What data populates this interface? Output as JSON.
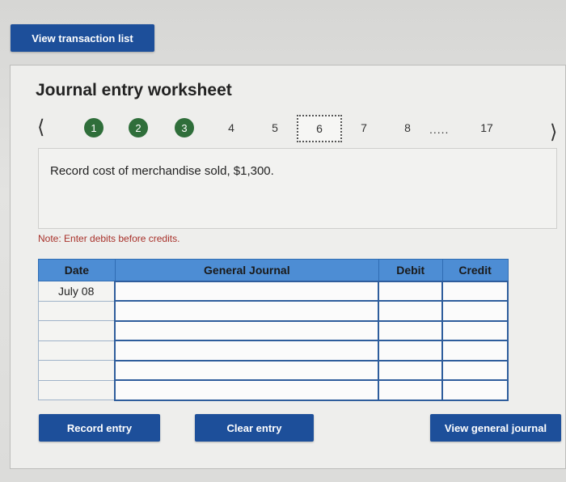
{
  "top": {
    "view_transactions_label": "View transaction list"
  },
  "worksheet": {
    "title": "Journal entry worksheet",
    "steps": [
      "1",
      "2",
      "3",
      "4",
      "5",
      "6",
      "7",
      "8",
      "17"
    ],
    "ellipsis": ".....",
    "current_step": "6",
    "completed_steps": [
      "1",
      "2",
      "3"
    ],
    "prev_icon": "chevron-left-icon",
    "next_icon": "chevron-right-icon",
    "prompt": "Record cost of merchandise sold, $1,300.",
    "note": "Note: Enter debits before credits."
  },
  "journal": {
    "headers": {
      "date": "Date",
      "general_journal": "General Journal",
      "debit": "Debit",
      "credit": "Credit"
    },
    "rows": [
      {
        "date": "July 08",
        "account": "",
        "debit": "",
        "credit": ""
      },
      {
        "date": "",
        "account": "",
        "debit": "",
        "credit": ""
      },
      {
        "date": "",
        "account": "",
        "debit": "",
        "credit": ""
      },
      {
        "date": "",
        "account": "",
        "debit": "",
        "credit": ""
      },
      {
        "date": "",
        "account": "",
        "debit": "",
        "credit": ""
      },
      {
        "date": "",
        "account": "",
        "debit": "",
        "credit": ""
      }
    ]
  },
  "actions": {
    "record_entry": "Record entry",
    "clear_entry": "Clear entry",
    "view_general_journal": "View general journal"
  },
  "colors": {
    "button_blue": "#1d4f9a",
    "header_blue": "#4d8dd4",
    "completed_green": "#2f6e3a",
    "note_red": "#a8312a"
  }
}
